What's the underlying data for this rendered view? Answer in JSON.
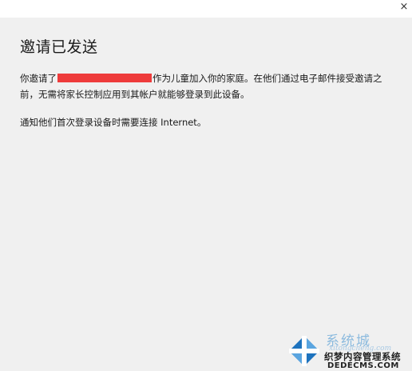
{
  "window": {
    "close_glyph": "×"
  },
  "dialog": {
    "title": "邀请已发送",
    "message": {
      "part1": "你邀请了",
      "part2": "作为儿童加入你的家庭。在他们通过电子邮件接受邀请之前，无需将家长控制应用到其帐户就能够登录到此设备。"
    },
    "note": "通知他们首次登录设备时需要连接 Internet。"
  },
  "watermark": {
    "cn": "系统城",
    "site": "xitongcheng.com",
    "dede": "织梦内容管理系统",
    "dede_url": "DEDECMS.COM",
    "colors": {
      "blue": "#1e73be",
      "light_blue": "#5aa5e0"
    }
  },
  "colors": {
    "background": "#f0f0f0",
    "redaction": "#ee3b3b",
    "text": "#1a1a1a"
  }
}
